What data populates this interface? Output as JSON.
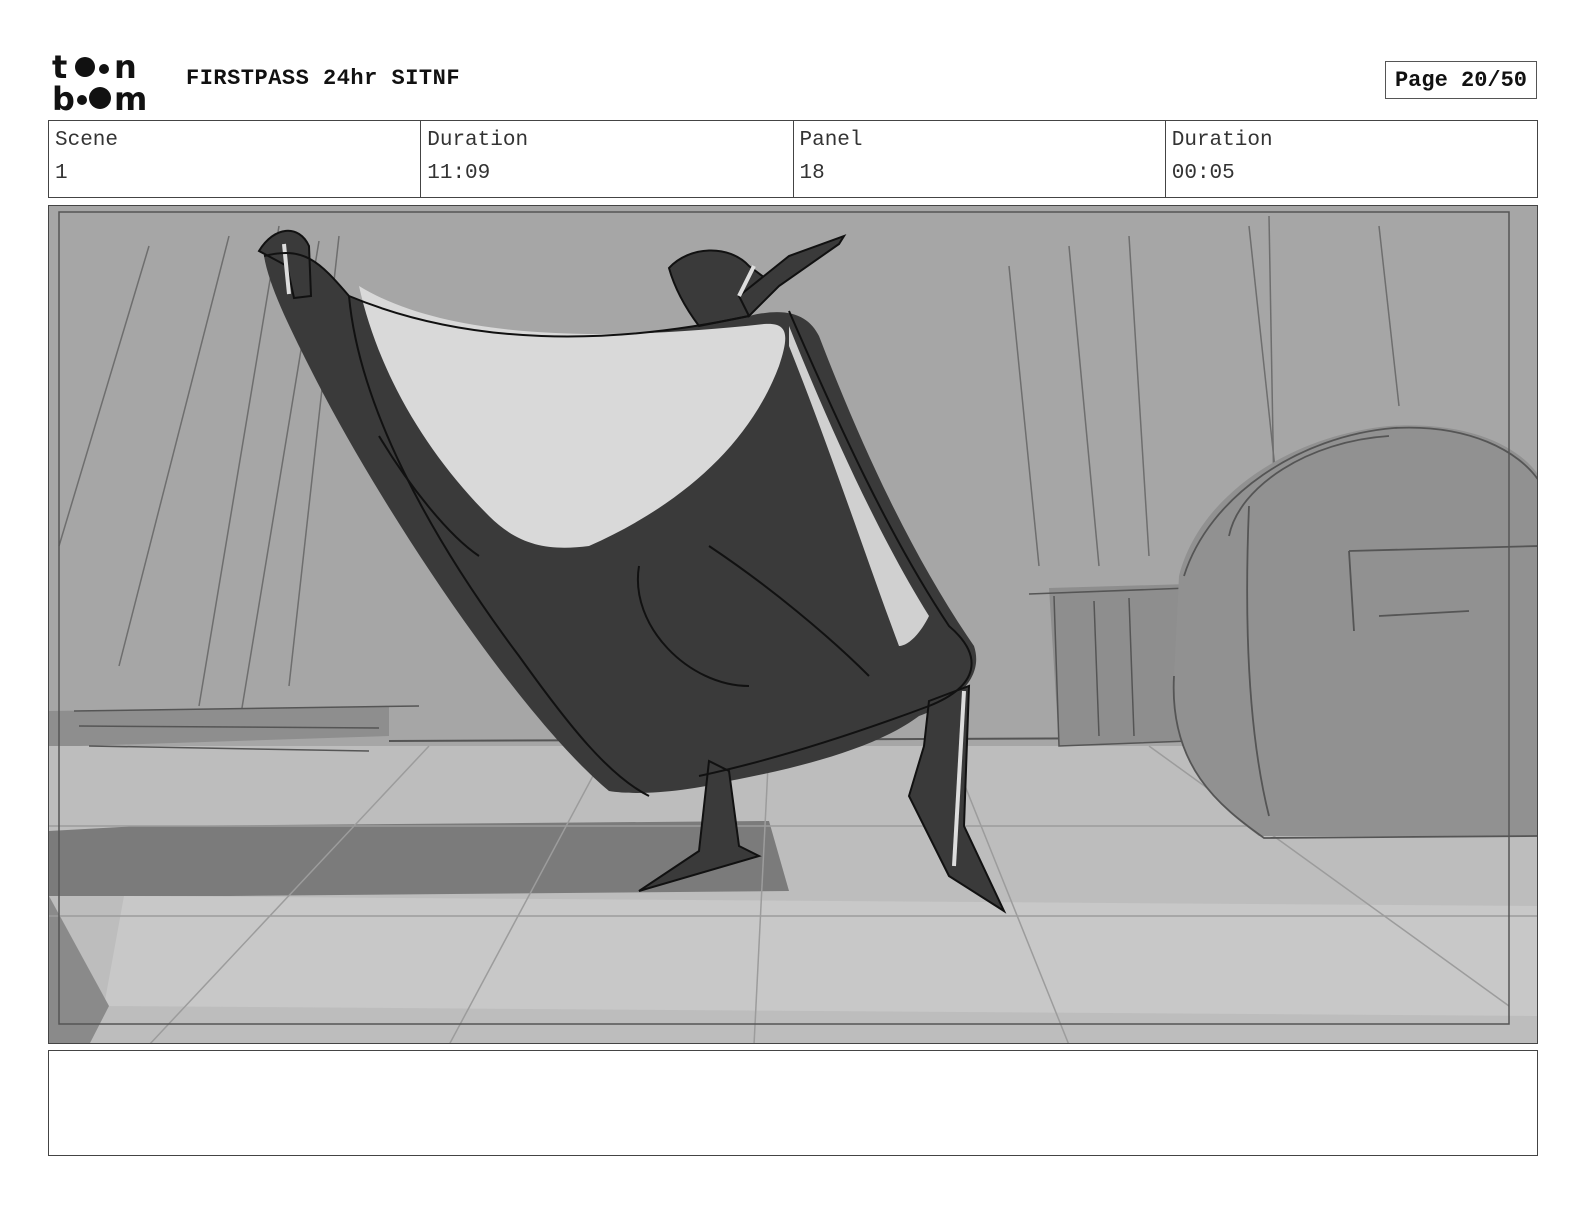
{
  "header": {
    "logo_icon": "toonboom-logo",
    "project_title": "FIRSTPASS 24hr SITNF",
    "page_counter": "Page 20/50"
  },
  "info": {
    "scene_label": "Scene",
    "scene_value": "1",
    "scene_duration_label": "Duration",
    "scene_duration_value": "11:09",
    "panel_label": "Panel",
    "panel_value": "18",
    "panel_duration_label": "Duration",
    "panel_duration_value": "00:05"
  },
  "panel": {
    "image_icon": "storyboard-sketch-cape-figure"
  },
  "notes": {
    "text": ""
  }
}
